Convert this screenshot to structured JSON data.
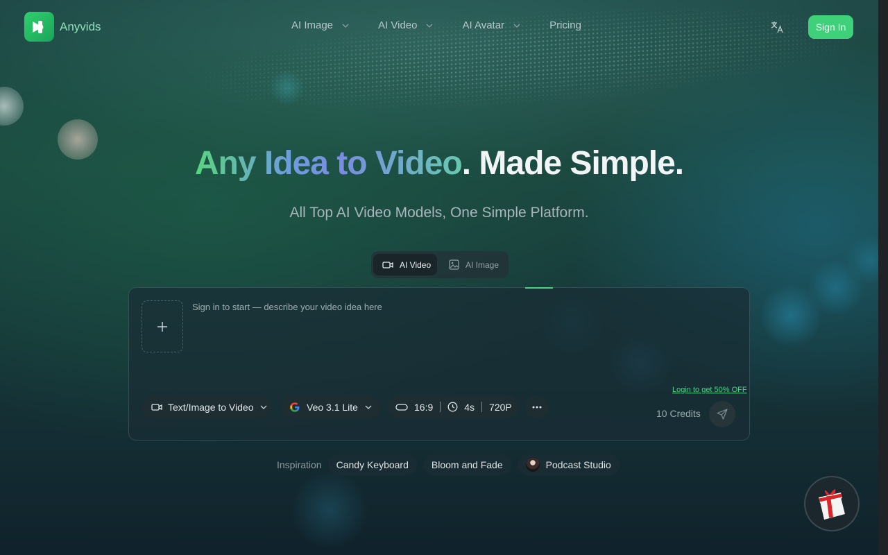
{
  "header": {
    "brand_name": "Anyvids",
    "nav": [
      {
        "label": "AI Image",
        "has_dropdown": true
      },
      {
        "label": "AI Video",
        "has_dropdown": true
      },
      {
        "label": "AI Avatar",
        "has_dropdown": true
      },
      {
        "label": "Pricing",
        "has_dropdown": false
      }
    ],
    "language_icon": "translate-icon",
    "sign_in_label": "Sign In"
  },
  "hero": {
    "title_gradient": "Any Idea to Video",
    "title_rest": ". Made Simple.",
    "subtitle": "All Top AI Video Models, One Simple Platform."
  },
  "mode_toggle": {
    "options": [
      {
        "label": "AI Video",
        "icon": "video-camera-icon",
        "active": true
      },
      {
        "label": "AI Image",
        "icon": "image-icon",
        "active": false
      }
    ]
  },
  "prompt_card": {
    "placeholder": "Sign in to start — describe your video idea here",
    "upload_icon": "plus-icon",
    "mode_select": "Text/Image to Video",
    "model_select": "Veo 3.1 Lite",
    "model_icon": "google-icon",
    "aspect_ratio": "16:9",
    "duration": "4s",
    "resolution": "720P",
    "more_icon": "more-horizontal-icon",
    "promo_link": "Login to get 50% OFF",
    "credits": "10 Credits",
    "send_icon": "send-icon"
  },
  "inspiration": {
    "label": "Inspiration",
    "chips": [
      "Candy Keyboard",
      "Bloom and Fade",
      "Podcast Studio"
    ]
  },
  "colors": {
    "accent_green": "#3fd07a",
    "brand_green": "#2fd06c",
    "background": "#1c4940"
  },
  "floating": {
    "gift_icon": "gift-box-icon"
  }
}
